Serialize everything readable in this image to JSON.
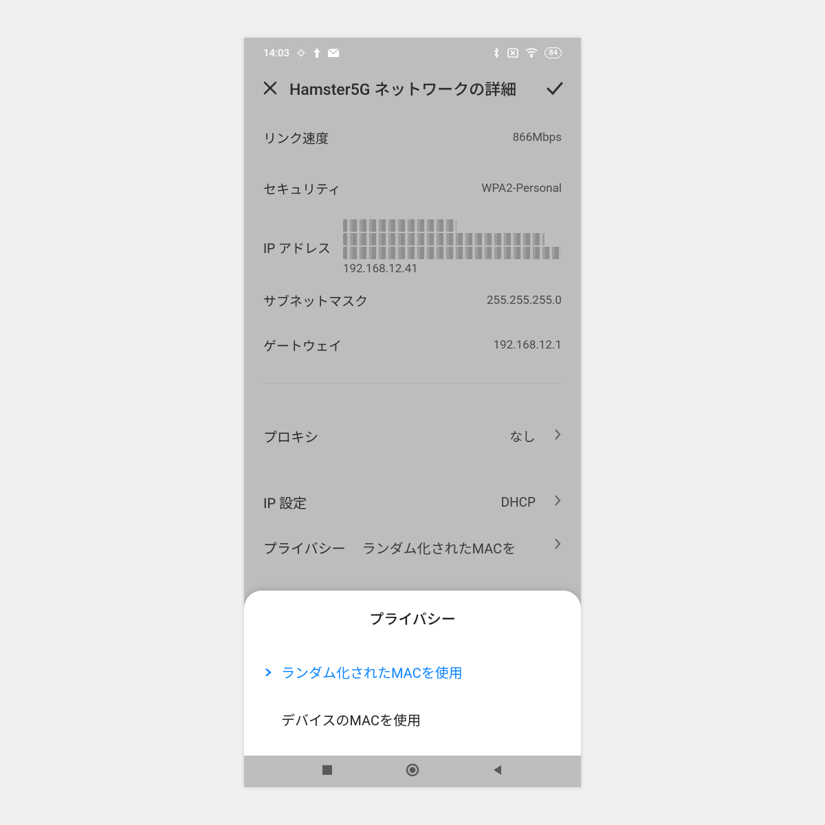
{
  "statusbar": {
    "time": "14:03",
    "battery": "84"
  },
  "header": {
    "title": "Hamster5G ネットワークの詳細"
  },
  "details": {
    "link_speed_label": "リンク速度",
    "link_speed_value": "866Mbps",
    "security_label": "セキュリティ",
    "security_value": "WPA2-Personal",
    "ip_label": "IP アドレス",
    "ip_visible": "192.168.12.41",
    "subnet_label": "サブネットマスク",
    "subnet_value": "255.255.255.0",
    "gateway_label": "ゲートウェイ",
    "gateway_value": "192.168.12.1"
  },
  "settings": {
    "proxy_label": "プロキシ",
    "proxy_value": "なし",
    "ip_settings_label": "IP 設定",
    "ip_settings_value": "DHCP",
    "privacy_label": "プライバシー",
    "privacy_value": "ランダム化されたMACを"
  },
  "sheet": {
    "title": "プライバシー",
    "option_random": "ランダム化されたMACを使用",
    "option_device": "デバイスのMACを使用"
  }
}
